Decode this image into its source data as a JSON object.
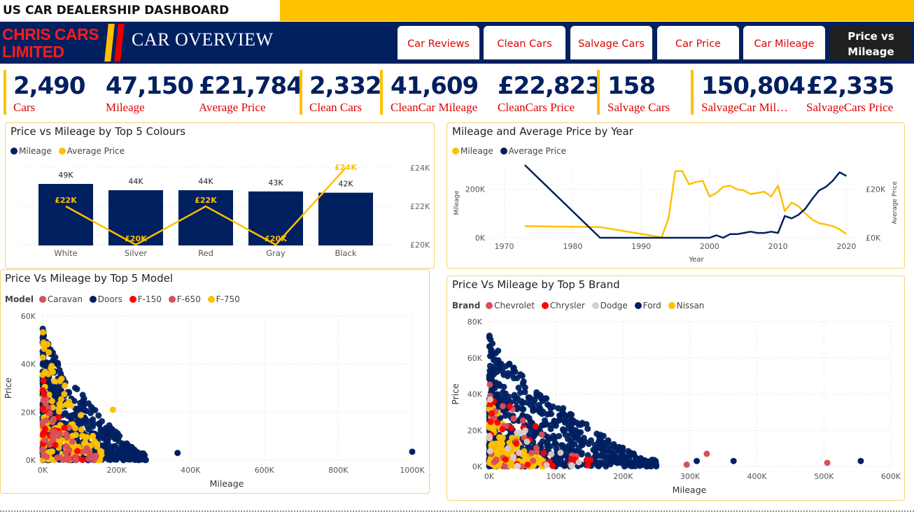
{
  "header": {
    "dashboard_title": "US CAR DEALERSHIP DASHBOARD",
    "brand": "CHRIS CARS LIMITED",
    "page_title": "CAR OVERVIEW",
    "tabs": [
      {
        "label": "Car Reviews",
        "active": false
      },
      {
        "label": "Clean Cars",
        "active": false
      },
      {
        "label": "Salvage Cars",
        "active": false
      },
      {
        "label": "Car Price",
        "active": false
      },
      {
        "label": "Car Mileage",
        "active": false
      },
      {
        "label": "Price vs Mileage",
        "active": true
      }
    ]
  },
  "colors": {
    "navy": "#002060",
    "yellow": "#ffc000",
    "red": "#e00000"
  },
  "kpis": [
    {
      "value": "2,490",
      "label": "Cars"
    },
    {
      "value": "47,150",
      "label": "Mileage"
    },
    {
      "value": "£21,784",
      "label": "Average Price"
    },
    {
      "value": "2,332",
      "label": "Clean Cars"
    },
    {
      "value": "41,609",
      "label": "CleanCar Mileage"
    },
    {
      "value": "£22,823",
      "label": "CleanCars Price"
    },
    {
      "value": "158",
      "label": "Salvage Cars"
    },
    {
      "value": "150,804",
      "label": "SalvageCar Mil…"
    },
    {
      "value": "£2,335",
      "label": "SalvageCars Price"
    }
  ],
  "chart_data": [
    {
      "type": "bar",
      "title": "Price vs Mileage by Top 5 Colours",
      "categories": [
        "White",
        "Silver",
        "Red",
        "Gray",
        "Black"
      ],
      "series": [
        {
          "name": "Mileage",
          "kind": "bar",
          "color": "#002060",
          "values": [
            49000,
            44000,
            44000,
            43000,
            42000
          ],
          "labels": [
            "49K",
            "44K",
            "44K",
            "43K",
            "42K"
          ]
        },
        {
          "name": "Average Price",
          "kind": "line",
          "color": "#ffc000",
          "values": [
            22000,
            20000,
            22000,
            20000,
            24000
          ],
          "labels": [
            "£22K",
            "£20K",
            "£22K",
            "£20K",
            "£24K"
          ]
        }
      ],
      "y2_ticks": [
        "£24K",
        "£22K",
        "£20K"
      ],
      "y2lim": [
        20000,
        24000
      ]
    },
    {
      "type": "line",
      "title": "Mileage and Average Price by Year",
      "xlabel": "Year",
      "ylabel": "Mileage",
      "y2label": "Average Price",
      "x_ticks": [
        "1970",
        "1980",
        "1990",
        "2000",
        "2010",
        "2020"
      ],
      "y_ticks": [
        "0K",
        "200K"
      ],
      "y2_ticks": [
        "£0K",
        "£20K"
      ],
      "xlim": [
        1968,
        2022
      ],
      "ylim": [
        0,
        300000
      ],
      "y2lim": [
        0,
        30000
      ],
      "series": [
        {
          "name": "Mileage",
          "color": "#ffc000",
          "axis": "y",
          "points": [
            [
              1973,
              48000
            ],
            [
              1984,
              44000
            ],
            [
              1993,
              2000
            ],
            [
              1994,
              80000
            ],
            [
              1995,
              275000
            ],
            [
              1996,
              275000
            ],
            [
              1997,
              220000
            ],
            [
              1998,
              230000
            ],
            [
              1999,
              235000
            ],
            [
              2000,
              170000
            ],
            [
              2001,
              185000
            ],
            [
              2002,
              210000
            ],
            [
              2003,
              215000
            ],
            [
              2004,
              200000
            ],
            [
              2005,
              195000
            ],
            [
              2006,
              180000
            ],
            [
              2007,
              185000
            ],
            [
              2008,
              190000
            ],
            [
              2009,
              170000
            ],
            [
              2010,
              215000
            ],
            [
              2011,
              110000
            ],
            [
              2012,
              145000
            ],
            [
              2013,
              130000
            ],
            [
              2014,
              100000
            ],
            [
              2015,
              75000
            ],
            [
              2016,
              60000
            ],
            [
              2017,
              55000
            ],
            [
              2018,
              48000
            ],
            [
              2019,
              35000
            ],
            [
              2020,
              15000
            ]
          ]
        },
        {
          "name": "Average Price",
          "color": "#002060",
          "axis": "y2",
          "points": [
            [
              1973,
              30000
            ],
            [
              1984,
              0
            ],
            [
              1993,
              0
            ],
            [
              1994,
              0
            ],
            [
              2000,
              0
            ],
            [
              2001,
              1000
            ],
            [
              2002,
              0
            ],
            [
              2003,
              1500
            ],
            [
              2004,
              1500
            ],
            [
              2005,
              2000
            ],
            [
              2006,
              2500
            ],
            [
              2007,
              2000
            ],
            [
              2008,
              2000
            ],
            [
              2009,
              2500
            ],
            [
              2010,
              2000
            ],
            [
              2011,
              9000
            ],
            [
              2012,
              8000
            ],
            [
              2013,
              9500
            ],
            [
              2014,
              12000
            ],
            [
              2015,
              16000
            ],
            [
              2016,
              19500
            ],
            [
              2017,
              21000
            ],
            [
              2018,
              23500
            ],
            [
              2019,
              27000
            ],
            [
              2020,
              25500
            ]
          ]
        }
      ]
    },
    {
      "type": "scatter",
      "title": "Price Vs Mileage by Top 5 Model",
      "legend_title": "Model",
      "xlabel": "Mileage",
      "ylabel": "Price",
      "x_ticks": [
        "0K",
        "200K",
        "400K",
        "600K",
        "800K",
        "1000K"
      ],
      "y_ticks": [
        "0K",
        "20K",
        "40K",
        "60K"
      ],
      "xlim": [
        0,
        1000000
      ],
      "ylim": [
        0,
        60000
      ],
      "series": [
        {
          "name": "Caravan",
          "color": "#d9505a",
          "n": 40,
          "xmax": 170000,
          "ymax": 30000
        },
        {
          "name": "Doors",
          "color": "#002060",
          "n": 650,
          "xmax": 280000,
          "ymax": 56000
        },
        {
          "name": "F-150",
          "color": "#ff0000",
          "n": 20,
          "xmax": 120000,
          "ymax": 40000
        },
        {
          "name": "F-650",
          "color": "#d9505a",
          "n": 15,
          "xmax": 100000,
          "ymax": 30000
        },
        {
          "name": "F-750",
          "color": "#ffc000",
          "n": 130,
          "xmax": 180000,
          "ymax": 58000
        }
      ],
      "outliers": [
        {
          "series": "Doors",
          "x": 365000,
          "y": 3000
        },
        {
          "series": "Doors",
          "x": 1000000,
          "y": 3500
        },
        {
          "series": "F-750",
          "x": 190000,
          "y": 21000
        }
      ]
    },
    {
      "type": "scatter",
      "title": "Price Vs Mileage by Top 5 Brand",
      "legend_title": "Brand",
      "xlabel": "Mileage",
      "ylabel": "Price",
      "x_ticks": [
        "0K",
        "100K",
        "200K",
        "300K",
        "400K",
        "500K",
        "600K"
      ],
      "y_ticks": [
        "0K",
        "20K",
        "40K",
        "60K",
        "80K"
      ],
      "xlim": [
        0,
        600000
      ],
      "ylim": [
        0,
        80000
      ],
      "series": [
        {
          "name": "Chevrolet",
          "color": "#d9505a",
          "n": 30,
          "xmax": 170000,
          "ymax": 50000
        },
        {
          "name": "Chrysler",
          "color": "#ff0000",
          "n": 25,
          "xmax": 180000,
          "ymax": 48000
        },
        {
          "name": "Dodge",
          "color": "#d8cfc4",
          "n": 20,
          "xmax": 150000,
          "ymax": 40000
        },
        {
          "name": "Ford",
          "color": "#002060",
          "n": 700,
          "xmax": 250000,
          "ymax": 74000
        },
        {
          "name": "Nissan",
          "color": "#ffc000",
          "n": 140,
          "xmax": 90000,
          "ymax": 40000
        }
      ],
      "outliers": [
        {
          "series": "Ford",
          "x": 555000,
          "y": 3000
        },
        {
          "series": "Ford",
          "x": 365000,
          "y": 3000
        },
        {
          "series": "Chevrolet",
          "x": 505000,
          "y": 2000
        },
        {
          "series": "Chevrolet",
          "x": 325000,
          "y": 7000
        },
        {
          "series": "Chevrolet",
          "x": 295000,
          "y": 1000
        },
        {
          "series": "Ford",
          "x": 310000,
          "y": 3000
        }
      ]
    }
  ]
}
